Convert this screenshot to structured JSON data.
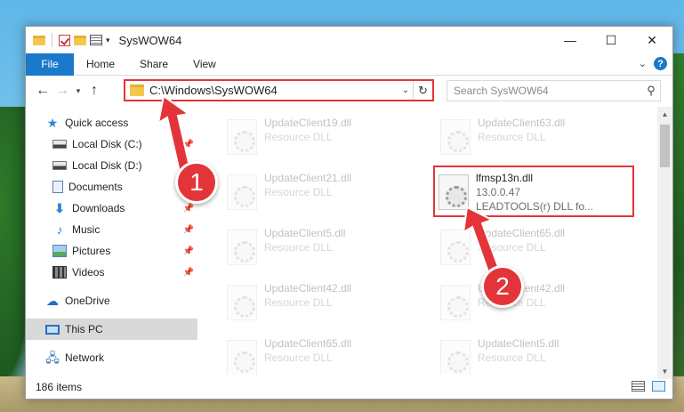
{
  "window": {
    "title": "SysWOW64",
    "controls": {
      "minimize": "—",
      "maximize": "☐",
      "close": "✕"
    }
  },
  "ribbon": {
    "file_tab": "File",
    "tabs": [
      "Home",
      "Share",
      "View"
    ],
    "help_glyph": "?"
  },
  "address_bar": {
    "path": "C:\\Windows\\SysWOW64",
    "search_placeholder": "Search SysWOW64"
  },
  "nav_pane": {
    "quick_access": "Quick access",
    "items": [
      {
        "label": "Local Disk (C:)",
        "icon": "local-disk-icon",
        "pinned": true
      },
      {
        "label": "Local Disk (D:)",
        "icon": "local-disk-icon",
        "pinned": false
      },
      {
        "label": "Documents",
        "icon": "documents-icon",
        "pinned": true
      },
      {
        "label": "Downloads",
        "icon": "downloads-icon",
        "pinned": true
      },
      {
        "label": "Music",
        "icon": "music-icon",
        "pinned": true
      },
      {
        "label": "Pictures",
        "icon": "pictures-icon",
        "pinned": true
      },
      {
        "label": "Videos",
        "icon": "videos-icon",
        "pinned": true
      }
    ],
    "onedrive": "OneDrive",
    "this_pc": "This PC",
    "network": "Network"
  },
  "files": {
    "left_column": [
      {
        "name": "UpdateClient19.dll",
        "type": "Resource DLL"
      },
      {
        "name": "",
        "type": ""
      },
      {
        "name": "UpdateClient21.dll",
        "type": "Resource DLL"
      },
      {
        "name": "UpdateClient5.dll",
        "type": "Resource DLL"
      },
      {
        "name": "UpdateClient42.dll",
        "type": "Resource DLL"
      },
      {
        "name": "UpdateClient65.dll",
        "type": "Resource DLL"
      }
    ],
    "right_column": [
      {
        "name": "UpdateClient63.dll",
        "type": "Resource DLL"
      },
      {
        "name": "UpdateClient65.dll",
        "type": "Resource DLL"
      },
      {
        "name": "UpdateClient42.dll",
        "type": "Resource DLL"
      },
      {
        "name": "UpdateClient5.dll",
        "type": "Resource DLL"
      }
    ],
    "selected": {
      "name": "lfmsp13n.dll",
      "version": "13.0.0.47",
      "description": "LEADTOOLS(r) DLL fo..."
    }
  },
  "status_bar": {
    "item_count": "186 items"
  },
  "callouts": {
    "one": "1",
    "two": "2"
  },
  "colors": {
    "accent": "#1979ca",
    "highlight": "#e3343a"
  }
}
